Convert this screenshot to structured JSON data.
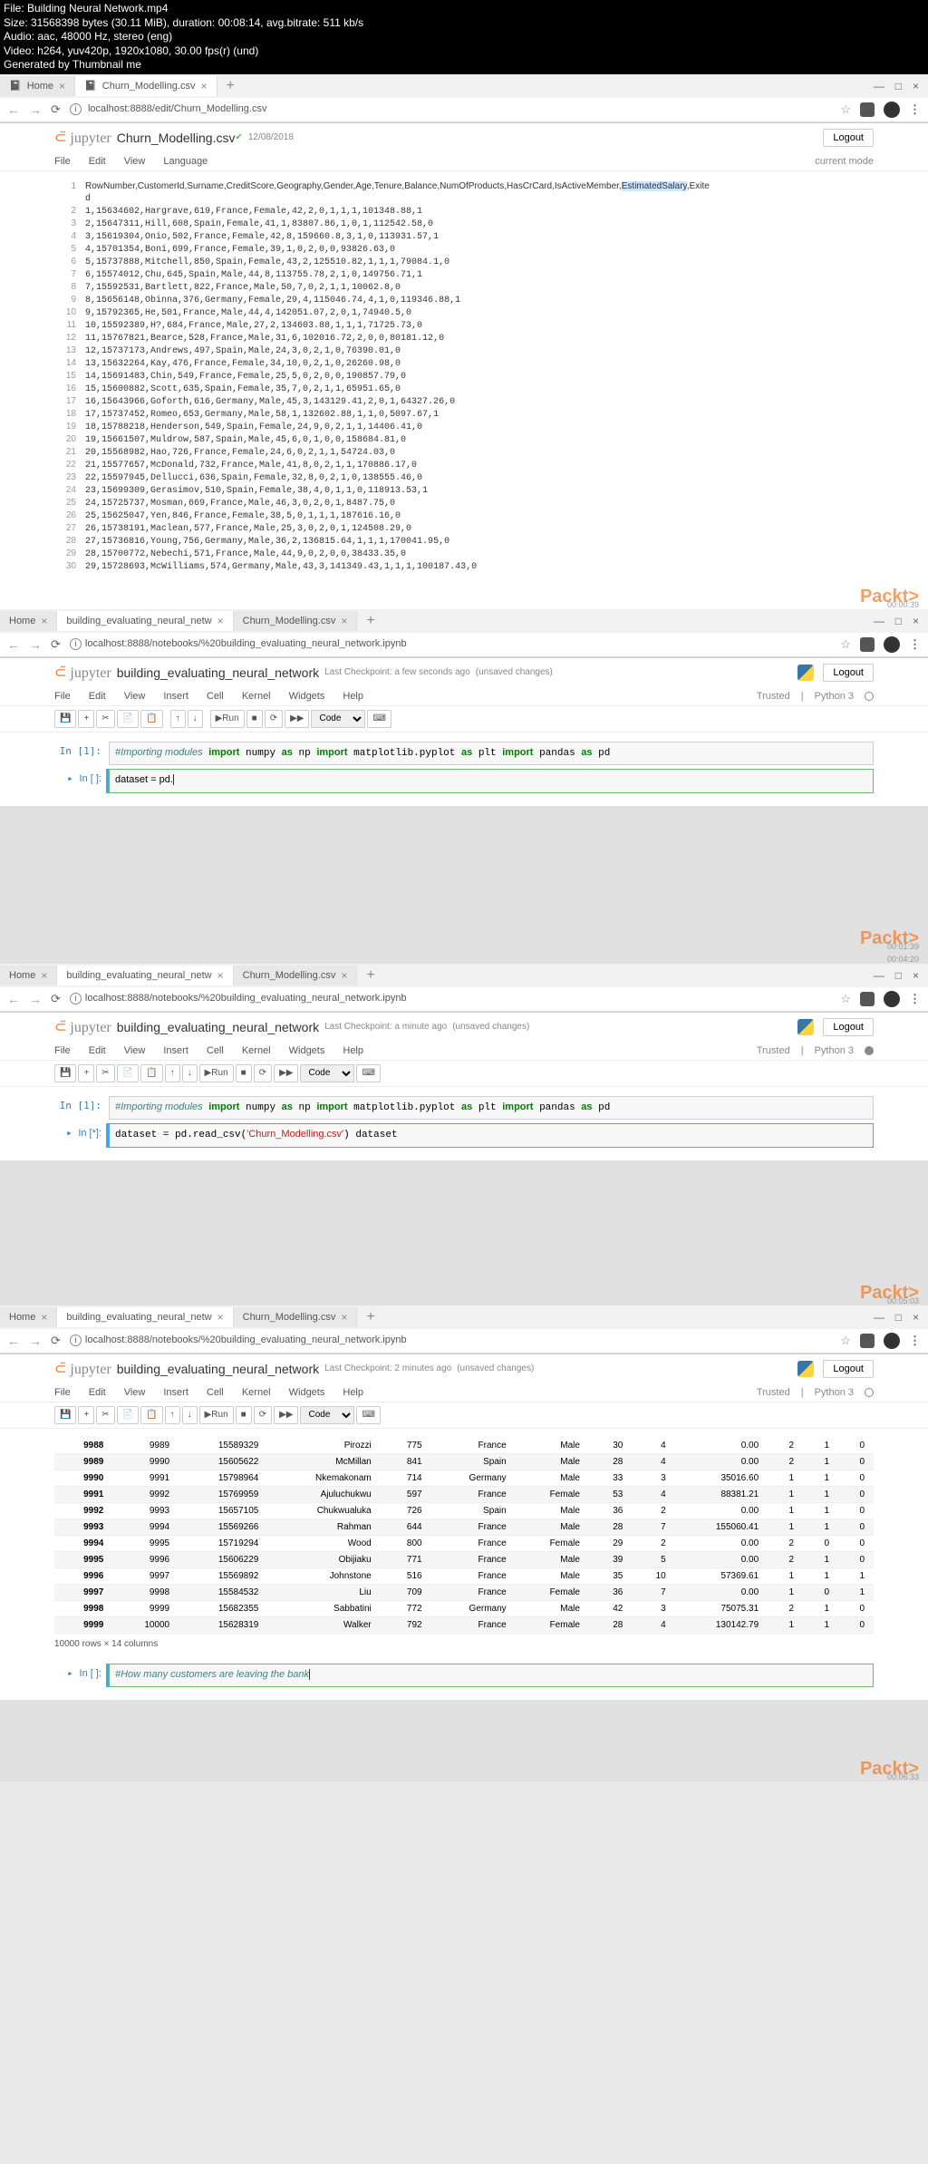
{
  "header_info": {
    "file": "File: Building Neural Network.mp4",
    "size": "Size: 31568398 bytes (30.11 MiB), duration: 00:08:14, avg.bitrate: 511 kb/s",
    "audio": "Audio: aac, 48000 Hz, stereo (eng)",
    "video": "Video: h264, yuv420p, 1920x1080, 30.00 fps(r) (und)",
    "gen": "Generated by Thumbnail me"
  },
  "frame1": {
    "tab1": "Home",
    "tab2": "Churn_Modelling.csv",
    "url": "localhost:8888/edit/Churn_Modelling.csv",
    "title": "Churn_Modelling.csv",
    "checkpoint": "12/08/2018",
    "logout": "Logout",
    "menus": [
      "File",
      "Edit",
      "View",
      "Language"
    ],
    "mode": "current mode",
    "csv_header": "RowNumber,CustomerId,Surname,CreditScore,Geography,Gender,Age,Tenure,Balance,NumOfProducts,HasCrCard,IsActiveMember,",
    "csv_header_hl": "EstimatedSalary",
    "csv_header_end": ",Exite",
    "csv_lines": [
      "d",
      "1,15634602,Hargrave,619,France,Female,42,2,0,1,1,1,101348.88,1",
      "2,15647311,Hill,608,Spain,Female,41,1,83807.86,1,0,1,112542.58,0",
      "3,15619304,Onio,502,France,Female,42,8,159660.8,3,1,0,113931.57,1",
      "4,15701354,Boni,699,France,Female,39,1,0,2,0,0,93826.63,0",
      "5,15737888,Mitchell,850,Spain,Female,43,2,125510.82,1,1,1,79084.1,0",
      "6,15574012,Chu,645,Spain,Male,44,8,113755.78,2,1,0,149756.71,1",
      "7,15592531,Bartlett,822,France,Male,50,7,0,2,1,1,10062.8,0",
      "8,15656148,Obinna,376,Germany,Female,29,4,115046.74,4,1,0,119346.88,1",
      "9,15792365,He,501,France,Male,44,4,142051.07,2,0,1,74940.5,0",
      "10,15592389,H?,684,France,Male,27,2,134603.88,1,1,1,71725.73,0",
      "11,15767821,Bearce,528,France,Male,31,6,102016.72,2,0,0,80181.12,0",
      "12,15737173,Andrews,497,Spain,Male,24,3,0,2,1,0,76390.01,0",
      "13,15632264,Kay,476,France,Female,34,10,0,2,1,0,26260.98,0",
      "14,15691483,Chin,549,France,Female,25,5,0,2,0,0,190857.79,0",
      "15,15600882,Scott,635,Spain,Female,35,7,0,2,1,1,65951.65,0",
      "16,15643966,Goforth,616,Germany,Male,45,3,143129.41,2,0,1,64327.26,0",
      "17,15737452,Romeo,653,Germany,Male,58,1,132602.88,1,1,0,5097.67,1",
      "18,15788218,Henderson,549,Spain,Female,24,9,0,2,1,1,14406.41,0",
      "19,15661507,Muldrow,587,Spain,Male,45,6,0,1,0,0,158684.81,0",
      "20,15568982,Hao,726,France,Female,24,6,0,2,1,1,54724.03,0",
      "21,15577657,McDonald,732,France,Male,41,8,0,2,1,1,170886.17,0",
      "22,15597945,Dellucci,636,Spain,Female,32,8,0,2,1,0,138555.46,0",
      "23,15699309,Gerasimov,510,Spain,Female,38,4,0,1,1,0,118913.53,1",
      "24,15725737,Mosman,669,France,Male,46,3,0,2,0,1,8487.75,0",
      "25,15625047,Yen,846,France,Female,38,5,0,1,1,1,187616.16,0",
      "26,15738191,Maclean,577,France,Male,25,3,0,2,0,1,124508.29,0",
      "27,15736816,Young,756,Germany,Male,36,2,136815.64,1,1,1,170041.95,0",
      "28,15700772,Nebechi,571,France,Male,44,9,0,2,0,0,38433.35,0",
      "29,15728693,McWilliams,574,Germany,Male,43,3,141349.43,1,1,1,100187.43,0"
    ],
    "watermark": "Packt>",
    "ts": "00:00:39"
  },
  "frame2": {
    "tab1": "Home",
    "tab2": "building_evaluating_neural_netw",
    "tab3": "Churn_Modelling.csv",
    "url": "localhost:8888/notebooks/%20building_evaluating_neural_network.ipynb",
    "title": "building_evaluating_neural_network",
    "checkpoint": "Last Checkpoint: a few seconds ago",
    "unsaved": "(unsaved changes)",
    "logout": "Logout",
    "menus": [
      "File",
      "Edit",
      "View",
      "Insert",
      "Cell",
      "Kernel",
      "Widgets",
      "Help"
    ],
    "trusted": "Trusted",
    "kernel": "Python 3",
    "run": "Run",
    "code_sel": "Code",
    "cell1_prompt": "In [1]:",
    "cell1_comment": "#Importing modules",
    "cell1_l2": "import numpy as np",
    "cell1_l3": "import matplotlib.pyplot as plt",
    "cell1_l4": "import pandas as pd",
    "cell2_prompt": "In [ ]:",
    "cell2_code": "dataset = pd.",
    "watermark": "Packt>",
    "ts": "00:01:39"
  },
  "frame3": {
    "tab1": "Home",
    "tab2": "building_evaluating_neural_netw",
    "tab3": "Churn_Modelling.csv",
    "url": "localhost:8888/notebooks/%20building_evaluating_neural_network.ipynb",
    "title": "building_evaluating_neural_network",
    "checkpoint": "Last Checkpoint: a minute ago",
    "unsaved": "(unsaved changes)",
    "cell2_prompt": "In [*]:",
    "cell2_l1": "dataset = pd.read_csv('Churn_Modelling.csv')",
    "cell2_l2": "dataset",
    "watermark": "Packt>",
    "ts1": "00:04:20",
    "ts2": "00:05:03"
  },
  "frame4": {
    "checkpoint": "Last Checkpoint: 2 minutes ago",
    "table_rows": [
      [
        "9988",
        "9989",
        "15589329",
        "Pirozzi",
        "775",
        "France",
        "Male",
        "30",
        "4",
        "0.00",
        "2",
        "1",
        "0"
      ],
      [
        "9989",
        "9990",
        "15605622",
        "McMillan",
        "841",
        "Spain",
        "Male",
        "28",
        "4",
        "0.00",
        "2",
        "1",
        "0"
      ],
      [
        "9990",
        "9991",
        "15798964",
        "Nkemakonam",
        "714",
        "Germany",
        "Male",
        "33",
        "3",
        "35016.60",
        "1",
        "1",
        "0"
      ],
      [
        "9991",
        "9992",
        "15769959",
        "Ajuluchukwu",
        "597",
        "France",
        "Female",
        "53",
        "4",
        "88381.21",
        "1",
        "1",
        "0"
      ],
      [
        "9992",
        "9993",
        "15657105",
        "Chukwualuka",
        "726",
        "Spain",
        "Male",
        "36",
        "2",
        "0.00",
        "1",
        "1",
        "0"
      ],
      [
        "9993",
        "9994",
        "15569266",
        "Rahman",
        "644",
        "France",
        "Male",
        "28",
        "7",
        "155060.41",
        "1",
        "1",
        "0"
      ],
      [
        "9994",
        "9995",
        "15719294",
        "Wood",
        "800",
        "France",
        "Female",
        "29",
        "2",
        "0.00",
        "2",
        "0",
        "0"
      ],
      [
        "9995",
        "9996",
        "15606229",
        "Obijiaku",
        "771",
        "France",
        "Male",
        "39",
        "5",
        "0.00",
        "2",
        "1",
        "0"
      ],
      [
        "9996",
        "9997",
        "15569892",
        "Johnstone",
        "516",
        "France",
        "Male",
        "35",
        "10",
        "57369.61",
        "1",
        "1",
        "1"
      ],
      [
        "9997",
        "9998",
        "15584532",
        "Liu",
        "709",
        "France",
        "Female",
        "36",
        "7",
        "0.00",
        "1",
        "0",
        "1"
      ],
      [
        "9998",
        "9999",
        "15682355",
        "Sabbatini",
        "772",
        "Germany",
        "Male",
        "42",
        "3",
        "75075.31",
        "2",
        "1",
        "0"
      ],
      [
        "9999",
        "10000",
        "15628319",
        "Walker",
        "792",
        "France",
        "Female",
        "28",
        "4",
        "130142.79",
        "1",
        "1",
        "0"
      ]
    ],
    "summary": "10000 rows × 14 columns",
    "cell_prompt": "In [ ]:",
    "cell_comment": "#How many customers are leaving the bank",
    "watermark": "Packt>",
    "ts": "00:06:33"
  }
}
